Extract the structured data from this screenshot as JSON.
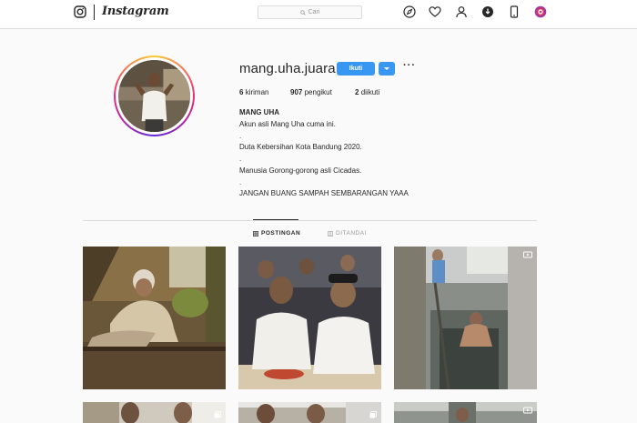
{
  "nav": {
    "wordmark": "Instagram",
    "search_placeholder": "Cari",
    "icons": [
      "instagram-glyph-icon",
      "compass-icon",
      "heart-icon",
      "person-icon",
      "igtv-icon",
      "phone-icon",
      "browser-extension-icon"
    ]
  },
  "profile": {
    "username": "mang.uha.juara",
    "follow_label": "Ikuti",
    "more_label": "···",
    "stats": {
      "posts_count": "6",
      "posts_label": "kiriman",
      "followers_count": "907",
      "followers_label": "pengikut",
      "following_count": "2",
      "following_label": "diikuti"
    },
    "full_name": "MANG UHA",
    "bio": [
      "Akun asli Mang Uha cuma ini.",
      ".",
      "Duta Kebersihan Kota Bandung 2020.",
      ".",
      "Manusia Gorong-gorong asli Cicadas.",
      ".",
      "JANGAN BUANG SAMPAH SEMBARANGAN YAAA"
    ]
  },
  "tabs": [
    {
      "label": "POSTINGAN",
      "icon": "grid-icon",
      "active": true
    },
    {
      "label": "DITANDAI",
      "icon": "tag-icon",
      "active": false
    }
  ],
  "posts": [
    {
      "media": "photo",
      "icon": null
    },
    {
      "media": "photo",
      "icon": null
    },
    {
      "media": "video",
      "icon": "video-icon"
    },
    {
      "media": "photo",
      "icon": "multi-icon"
    },
    {
      "media": "photo",
      "icon": "multi-icon"
    },
    {
      "media": "video",
      "icon": "video-icon"
    }
  ],
  "colors": {
    "accent": "#3897f0",
    "border": "#dbdbdb",
    "background": "#fafafa",
    "text": "#262626"
  }
}
